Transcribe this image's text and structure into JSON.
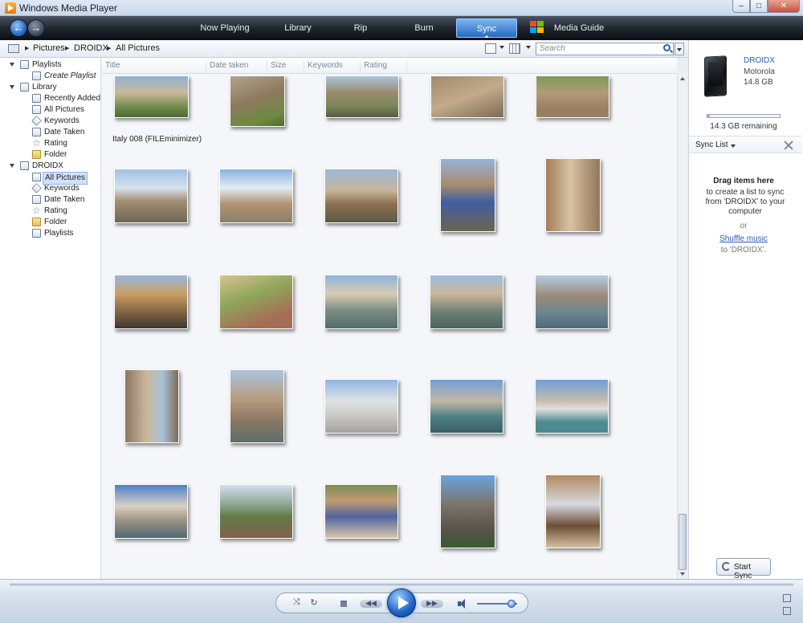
{
  "window": {
    "title": "Windows Media Player"
  },
  "nav": {
    "tabs": [
      "Now Playing",
      "Library",
      "Rip",
      "Burn",
      "Sync",
      "Media Guide"
    ],
    "active_tab": "Sync"
  },
  "breadcrumb": [
    "Pictures",
    "DROIDX",
    "All Pictures"
  ],
  "search": {
    "placeholder": "Search"
  },
  "columns": [
    "Title",
    "Date taken",
    "Size",
    "Keywords",
    "Rating"
  ],
  "tree": {
    "playlists": {
      "label": "Playlists",
      "children": [
        "Create Playlist"
      ]
    },
    "library": {
      "label": "Library",
      "children": [
        "Recently Added",
        "All Pictures",
        "Keywords",
        "Date Taken",
        "Rating",
        "Folder"
      ]
    },
    "device": {
      "label": "DROIDX",
      "children": [
        "All Pictures",
        "Keywords",
        "Date Taken",
        "Rating",
        "Folder",
        "Playlists"
      ],
      "selected": "All Pictures"
    }
  },
  "content": {
    "hover_caption": "Italy 008 (FILEminimizer)"
  },
  "device_panel": {
    "name": "DROIDX",
    "maker": "Motorola",
    "capacity": "14.8 GB",
    "remaining": "14.3 GB remaining",
    "used_fraction": 0.03,
    "sync_list_label": "Sync List",
    "drag_heading": "Drag items here",
    "drag_desc": "to create a list to sync from 'DROIDX' to your computer",
    "or": "or",
    "shuffle_link": "Shuffle music",
    "to_device": "to 'DROIDX'.",
    "start_sync": "Start Sync"
  },
  "player": {
    "volume_fraction": 0.85
  }
}
